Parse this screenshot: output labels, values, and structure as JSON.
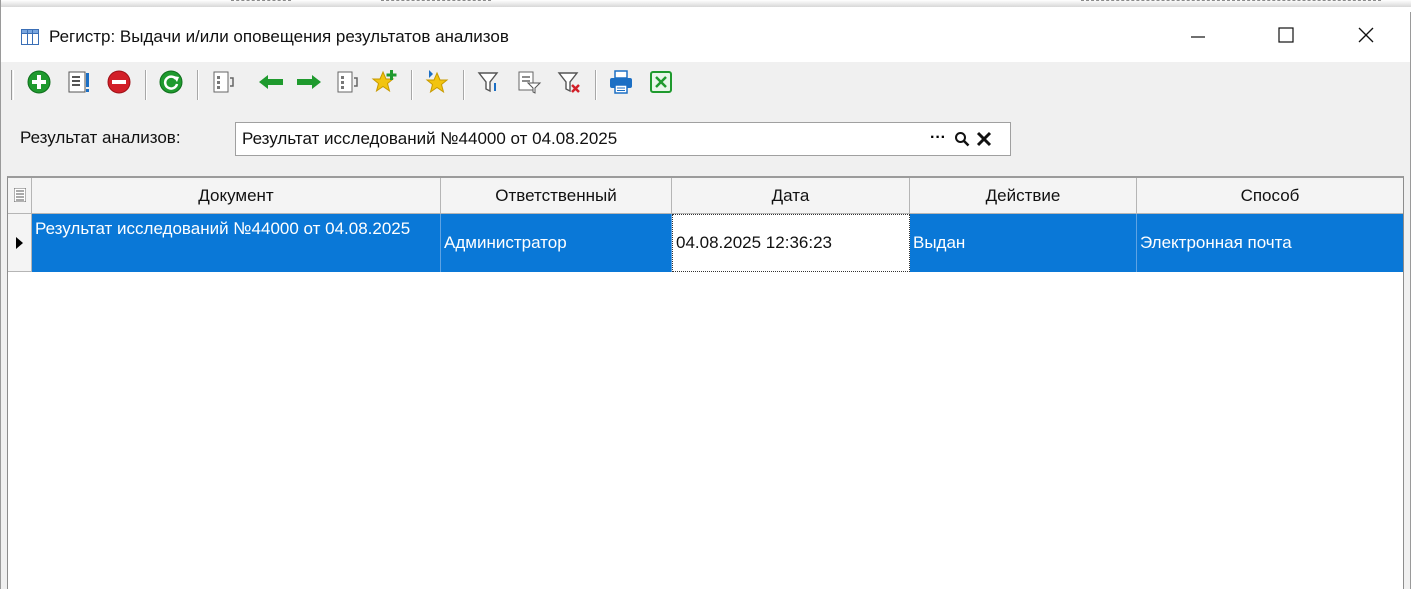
{
  "window": {
    "title": "Регистр: Выдачи и/или оповещения результатов анализов",
    "minimize_icon": "minimize-icon",
    "maximize_icon": "maximize-icon",
    "close_icon": "close-icon"
  },
  "toolbar": {
    "buttons": [
      {
        "name": "add-button",
        "icon": "plus-circle-icon"
      },
      {
        "name": "edit-button",
        "icon": "edit-form-icon"
      },
      {
        "name": "delete-button",
        "icon": "minus-circle-icon"
      },
      {
        "name": "refresh-button",
        "icon": "refresh-icon"
      },
      {
        "name": "first-record-button",
        "icon": "record-first-icon"
      },
      {
        "name": "prev-record-button",
        "icon": "arrow-left-icon"
      },
      {
        "name": "next-record-button",
        "icon": "arrow-right-icon"
      },
      {
        "name": "last-record-button",
        "icon": "record-last-icon"
      },
      {
        "name": "add-favorite-button",
        "icon": "star-plus-icon"
      },
      {
        "name": "favorites-button",
        "icon": "star-arrow-icon"
      },
      {
        "name": "filter-button",
        "icon": "filter-icon"
      },
      {
        "name": "filter-edit-button",
        "icon": "filter-edit-icon"
      },
      {
        "name": "filter-clear-button",
        "icon": "filter-clear-icon"
      },
      {
        "name": "print-button",
        "icon": "printer-icon"
      },
      {
        "name": "excel-export-button",
        "icon": "excel-icon"
      }
    ],
    "colors": {
      "green": "#1f9a2e",
      "red": "#d21f28",
      "yellow": "#f2c40f",
      "blue": "#1c6fc4"
    }
  },
  "filter": {
    "label": "Результат анализов:",
    "value": "Результат исследований №44000 от 04.08.2025",
    "ellipsis": "···",
    "search_icon": "search-icon",
    "clear_icon": "clear-icon"
  },
  "grid": {
    "columns": [
      "Документ",
      "Ответственный",
      "Дата",
      "Действие",
      "Способ"
    ],
    "rows": [
      {
        "document": "Результат исследований №44000 от 04.08.2025",
        "responsible": "Администратор",
        "date": "04.08.2025 12:36:23",
        "action": "Выдан",
        "method": "Электронная почта"
      }
    ],
    "selection_color": "#0a78d7"
  }
}
